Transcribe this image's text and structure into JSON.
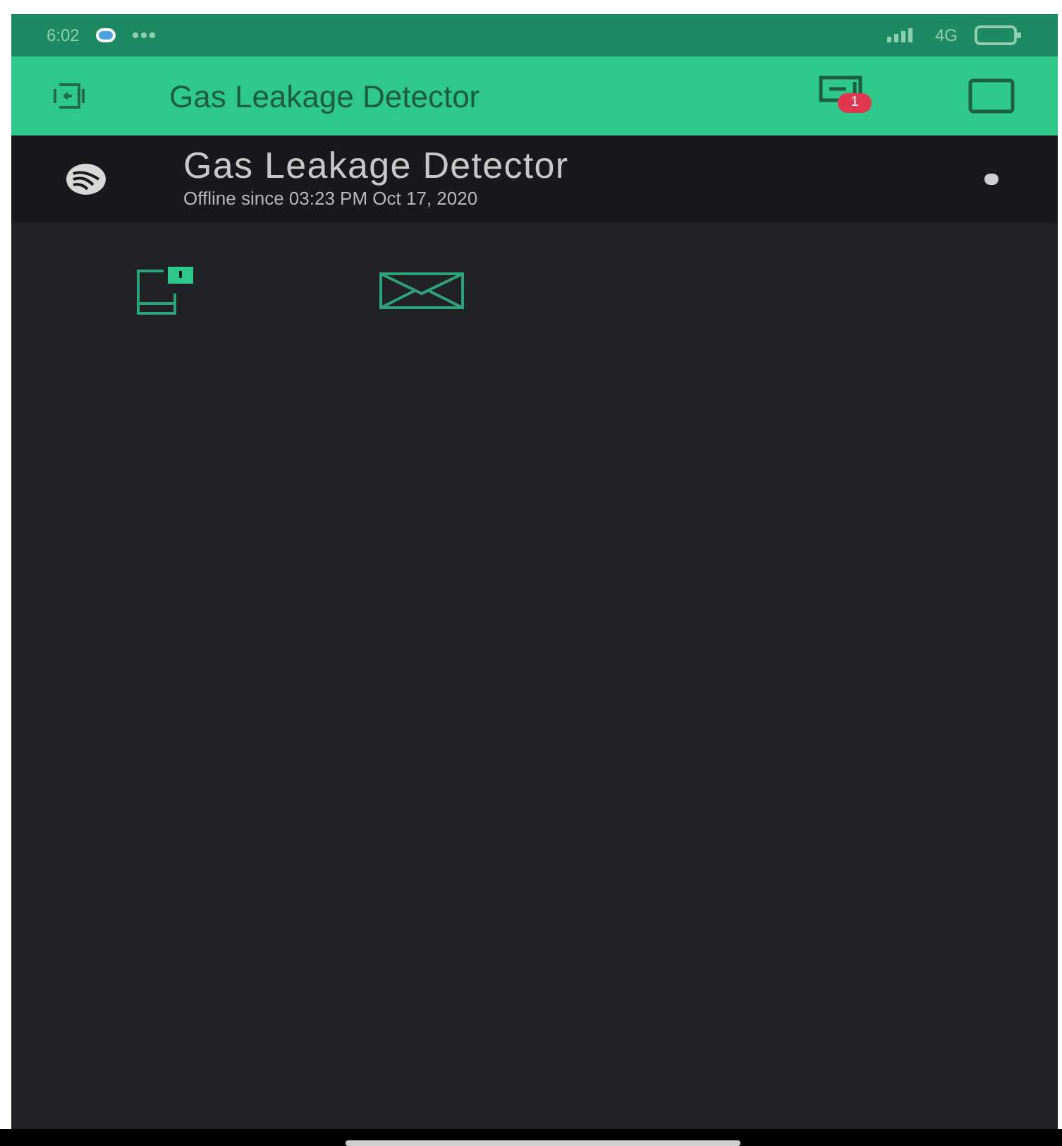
{
  "status_bar": {
    "time": "6:02",
    "network": "4G"
  },
  "header": {
    "title": "Gas Leakage Detector",
    "notification_count": "1"
  },
  "device": {
    "name": "Gas Leakage Detector",
    "status": "Offline since 03:23 PM Oct 17, 2020",
    "online": false
  },
  "widgets": [
    {
      "kind": "notification"
    },
    {
      "kind": "email"
    }
  ]
}
